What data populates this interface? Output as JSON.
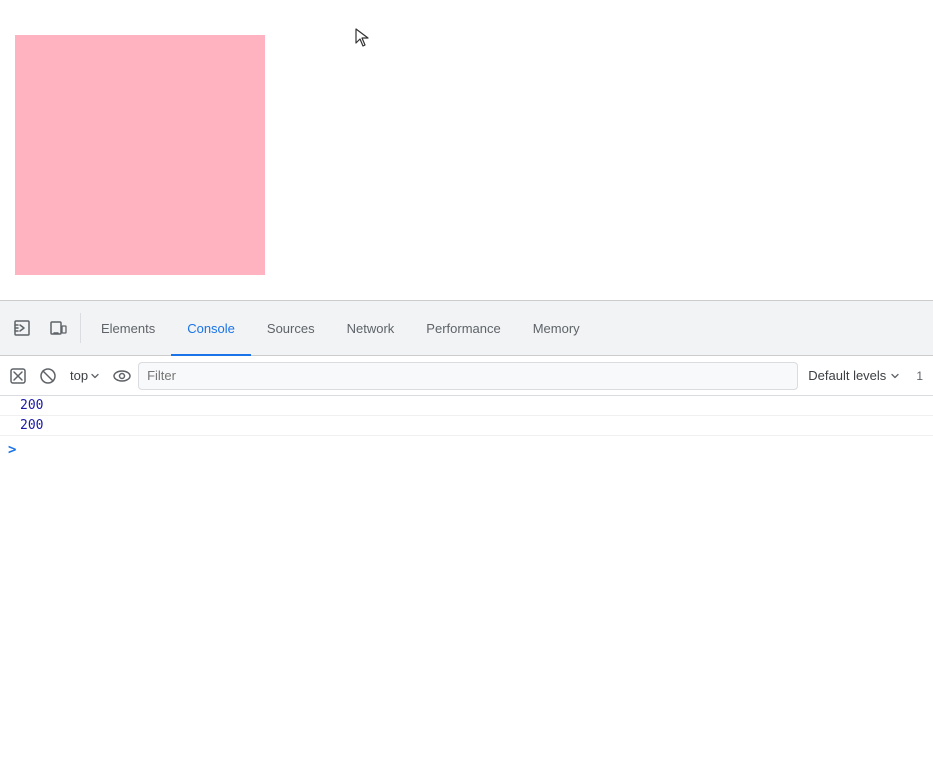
{
  "page": {
    "background": "#ffffff"
  },
  "pink_box": {
    "color": "#ffb3c1"
  },
  "devtools": {
    "tabs": [
      {
        "id": "elements",
        "label": "Elements",
        "active": false
      },
      {
        "id": "console",
        "label": "Console",
        "active": true
      },
      {
        "id": "sources",
        "label": "Sources",
        "active": false
      },
      {
        "id": "network",
        "label": "Network",
        "active": false
      },
      {
        "id": "performance",
        "label": "Performance",
        "active": false
      },
      {
        "id": "memory",
        "label": "Memory",
        "active": false
      }
    ],
    "toolbar": {
      "context_label": "top",
      "filter_placeholder": "Filter",
      "levels_label": "Default levels",
      "count": "1"
    },
    "console_lines": [
      {
        "value": "200"
      },
      {
        "value": "200"
      }
    ],
    "prompt_symbol": ">"
  }
}
